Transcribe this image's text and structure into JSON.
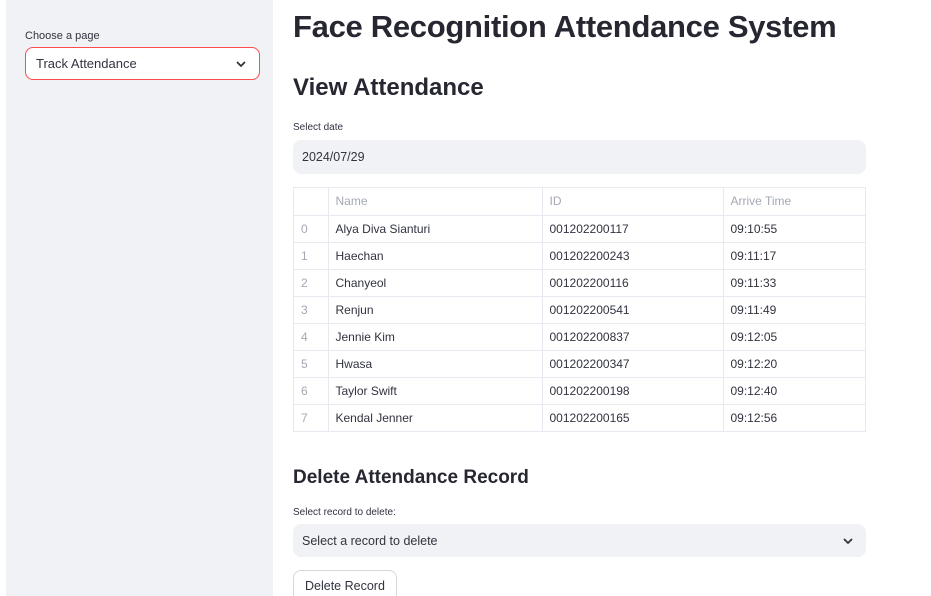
{
  "sidebar": {
    "page_select_label": "Choose a page",
    "page_select_value": "Track Attendance",
    "chevron_icon": "chevron-down-icon"
  },
  "main": {
    "title": "Face Recognition Attendance System",
    "view_heading": "View Attendance",
    "date_label": "Select date",
    "date_value": "2024/07/29",
    "table": {
      "columns": [
        "",
        "Name",
        "ID",
        "Arrive Time"
      ],
      "rows": [
        [
          "0",
          "Alya Diva Sianturi",
          "001202200117",
          "09:10:55"
        ],
        [
          "1",
          "Haechan",
          "001202200243",
          "09:11:17"
        ],
        [
          "2",
          "Chanyeol",
          "001202200116",
          "09:11:33"
        ],
        [
          "3",
          "Renjun",
          "001202200541",
          "09:11:49"
        ],
        [
          "4",
          "Jennie Kim",
          "001202200837",
          "09:12:05"
        ],
        [
          "5",
          "Hwasa",
          "001202200347",
          "09:12:20"
        ],
        [
          "6",
          "Taylor Swift",
          "001202200198",
          "09:12:40"
        ],
        [
          "7",
          "Kendal Jenner",
          "001202200165",
          "09:12:56"
        ]
      ]
    },
    "delete_heading": "Delete Attendance Record",
    "delete_label": "Select record to delete:",
    "delete_select_placeholder": "Select a record to delete",
    "delete_button_label": "Delete Record"
  },
  "colors": {
    "accent": "#ff4b4b",
    "sidebar_bg": "#f0f2f6",
    "input_bg": "#f0f2f6",
    "text": "#31333f"
  }
}
